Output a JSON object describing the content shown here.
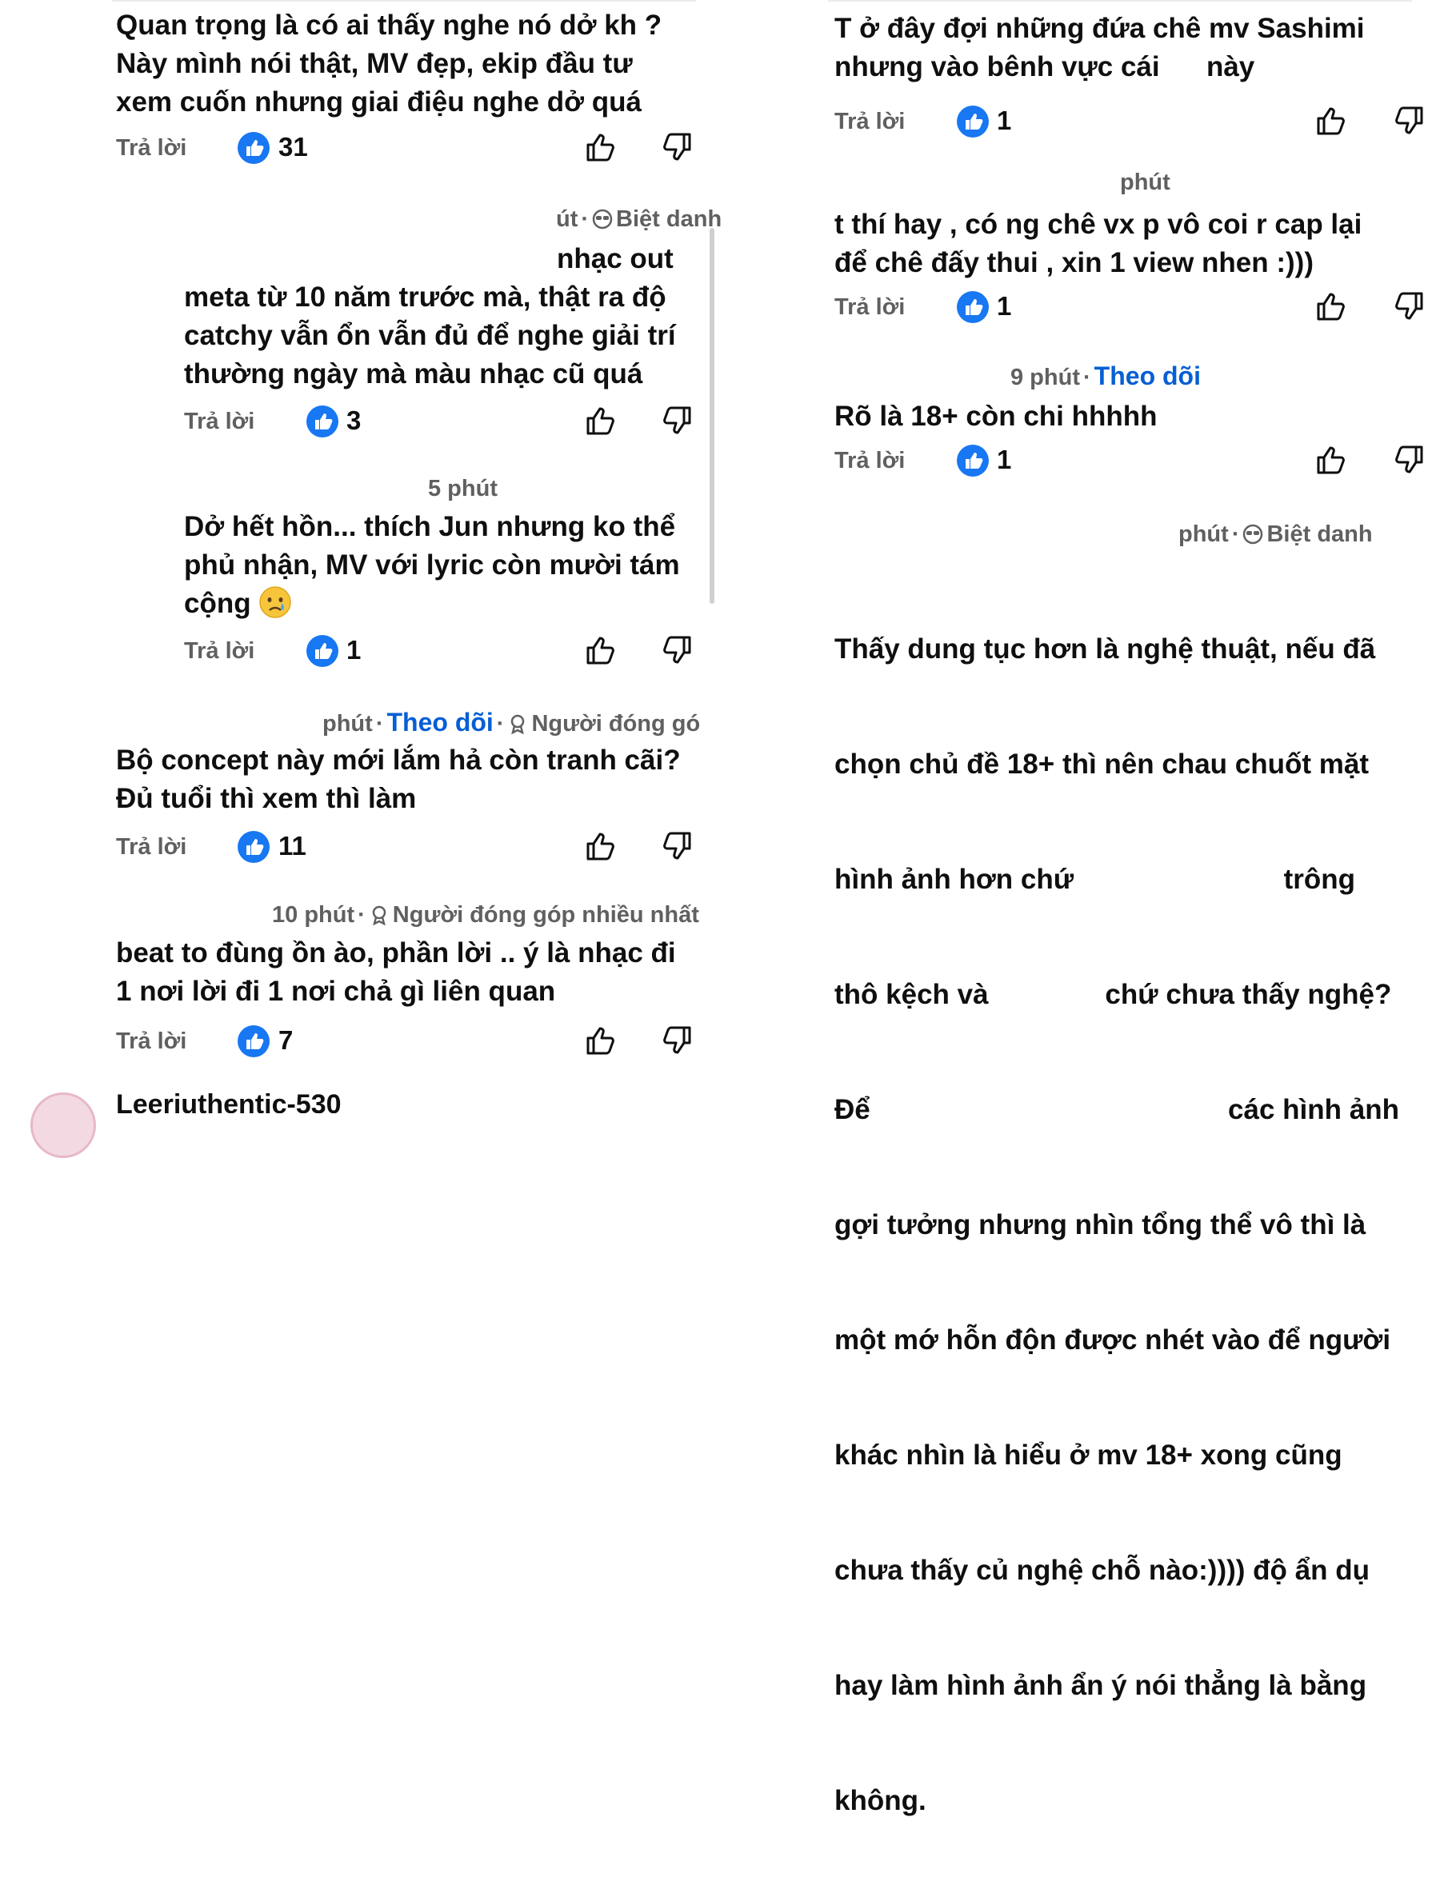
{
  "colors": {
    "accent": "#065fd4",
    "text": "#0f0f0f",
    "muted": "#606060",
    "like_badge": "#1877f2"
  },
  "icons": {
    "like_badge": "thumbs-up-badge-icon",
    "like": "thumbs-up-icon",
    "dislike": "thumbs-down-icon",
    "contributor": "contributor-medal-icon",
    "nickname": "sunglasses-icon"
  },
  "left": {
    "c1": {
      "lines": [
        "Quan trọng là có ai thấy nghe nó dở kh ?",
        "Này mình nói thật, MV đẹp, ekip đầu tư",
        "xem cuốn nhưng giai điệu nghe dở quá"
      ],
      "reply": "Trả lời",
      "likes": "31"
    },
    "c2": {
      "meta_time": "út",
      "meta_badge": "Biệt danh",
      "lines": [
        "nhạc out",
        "meta từ 10 năm trước mà, thật ra độ",
        "catchy vẫn ổn vẫn đủ để nghe giải trí",
        "thường ngày mà màu nhạc cũ quá"
      ],
      "reply": "Trả lời",
      "likes": "3"
    },
    "c3": {
      "meta_time": "5 phút",
      "lines": [
        "Dở hết hồn... thích Jun nhưng ko thể",
        "phủ nhận, MV với lyric còn mười tám",
        "cộng"
      ],
      "reply": "Trả lời",
      "likes": "1"
    },
    "c4": {
      "meta_time": "phút",
      "meta_follow": "Theo dõi",
      "meta_badge": "Người đóng gó",
      "lines": [
        "Bộ concept này mới lắm hả còn tranh cãi?",
        "Đủ tuổi thì xem thì làm"
      ],
      "reply": "Trả lời",
      "likes": "11"
    },
    "c5": {
      "meta_time": "10 phút",
      "meta_badge": "Người đóng góp nhiều nhất",
      "lines": [
        "beat to đùng ồn ào, phần lời .. ý là nhạc đi",
        "1 nơi lời đi 1 nơi chả gì liên quan"
      ],
      "reply": "Trả lời",
      "likes": "7"
    },
    "peek": {
      "name": "Leeriuthentic-530"
    }
  },
  "right": {
    "c1": {
      "lines": [
        "T ở đây đợi những đứa chê mv Sashimi",
        "nhưng vào bênh vực cái      này"
      ],
      "reply": "Trả lời",
      "likes": "1"
    },
    "c2": {
      "meta_time": "phút",
      "lines": [
        "t thí hay , có ng chê vx p vô coi r cap lại",
        "để chê đấy thui , xin 1 view nhen :)))"
      ],
      "reply": "Trả lời",
      "likes": "1"
    },
    "c3": {
      "meta_time": "9 phút",
      "meta_follow": "Theo dõi",
      "lines": [
        "Rõ là 18+ còn chi hhhhh"
      ],
      "reply": "Trả lời",
      "likes": "1"
    },
    "c4": {
      "meta_time": "phút",
      "meta_badge": "Biệt danh",
      "lines": [
        "Thấy dung tục hơn là nghệ thuật, nếu đã",
        "chọn chủ đề 18+ thì nên chau chuốt mặt",
        "hình ảnh hơn chứ                           trông",
        "thô kệch và               chứ chưa thấy nghệ?",
        "Để                                              các hình ảnh",
        "gợi tưởng nhưng nhìn tổng thể vô thì là",
        "một mớ hỗn độn được nhét vào để người",
        "khác nhìn là hiểu ở mv 18+ xong cũng",
        "chưa thấy củ nghệ chỗ nào:)))) độ ẩn dụ",
        "hay làm hình ảnh ẩn ý nói thẳng là bằng",
        "không."
      ]
    }
  }
}
